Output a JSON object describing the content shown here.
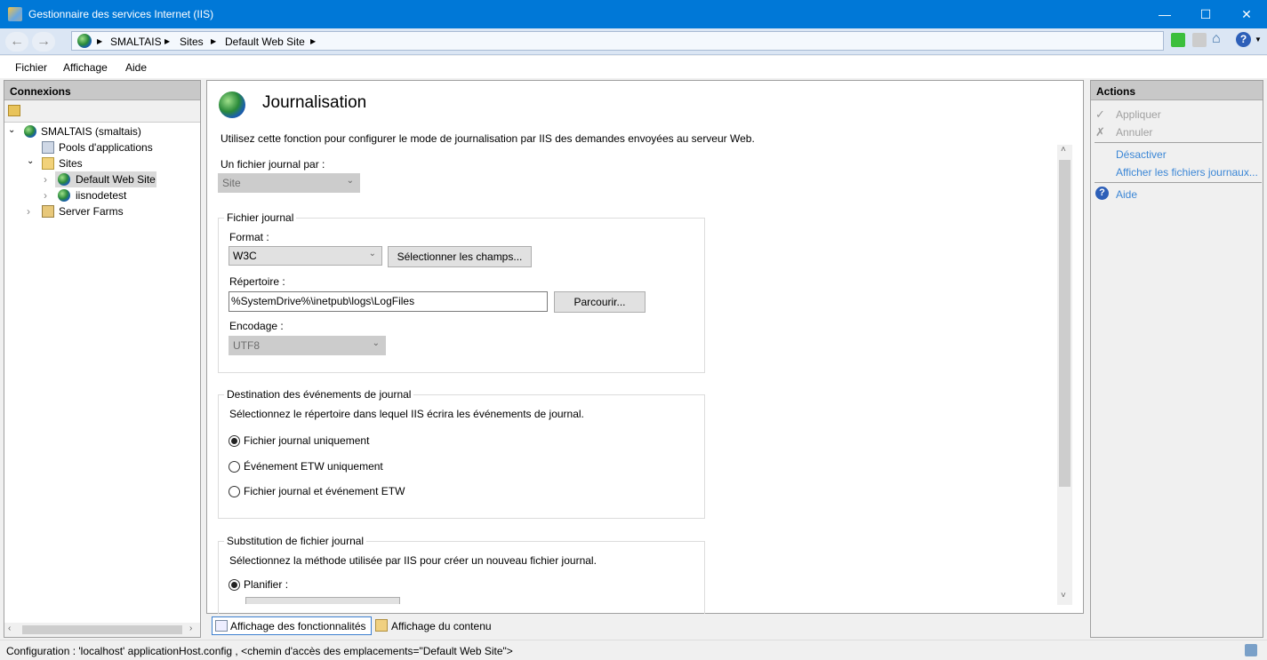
{
  "window": {
    "title": "Gestionnaire des services Internet (IIS)"
  },
  "address": {
    "crumbs": [
      "SMALTAIS",
      "Sites",
      "Default Web Site"
    ]
  },
  "menu": [
    "Fichier",
    "Affichage",
    "Aide"
  ],
  "connections": {
    "title": "Connexions",
    "tree": [
      {
        "label": "SMALTAIS (smaltais)"
      },
      {
        "label": "Pools d'applications"
      },
      {
        "label": "Sites"
      },
      {
        "label": "Default Web Site",
        "selected": true
      },
      {
        "label": "iisnodetest"
      },
      {
        "label": "Server Farms"
      }
    ]
  },
  "main": {
    "title": "Journalisation",
    "description": "Utilisez cette fonction pour configurer le mode de journalisation par IIS des demandes envoyées au serveur Web.",
    "per_label": "Un fichier journal par :",
    "per_value": "Site",
    "logfile": {
      "title": "Fichier journal",
      "format_label": "Format :",
      "format_value": "W3C",
      "select_fields": "Sélectionner les champs...",
      "dir_label": "Répertoire :",
      "dir_value": "%SystemDrive%\\inetpub\\logs\\LogFiles",
      "browse": "Parcourir...",
      "enc_label": "Encodage :",
      "enc_value": "UTF8"
    },
    "destination": {
      "title": "Destination des événements de journal",
      "desc": "Sélectionnez le répertoire dans lequel IIS écrira les événements de journal.",
      "options": [
        "Fichier journal uniquement",
        "Événement ETW uniquement",
        "Fichier journal et événement ETW"
      ],
      "selected": 0
    },
    "rollover": {
      "title": "Substitution de fichier journal",
      "desc": "Sélectionnez la méthode utilisée par IIS pour créer un nouveau fichier journal.",
      "schedule": "Planifier :"
    }
  },
  "views": {
    "features": "Affichage des fonctionnalités",
    "content": "Affichage du contenu"
  },
  "actions": {
    "title": "Actions",
    "apply": "Appliquer",
    "cancel": "Annuler",
    "disable": "Désactiver",
    "view_logs": "Afficher les fichiers journaux...",
    "help": "Aide"
  },
  "status": "Configuration : 'localhost' applicationHost.config , <chemin d'accès des emplacements=\"Default Web Site\">"
}
